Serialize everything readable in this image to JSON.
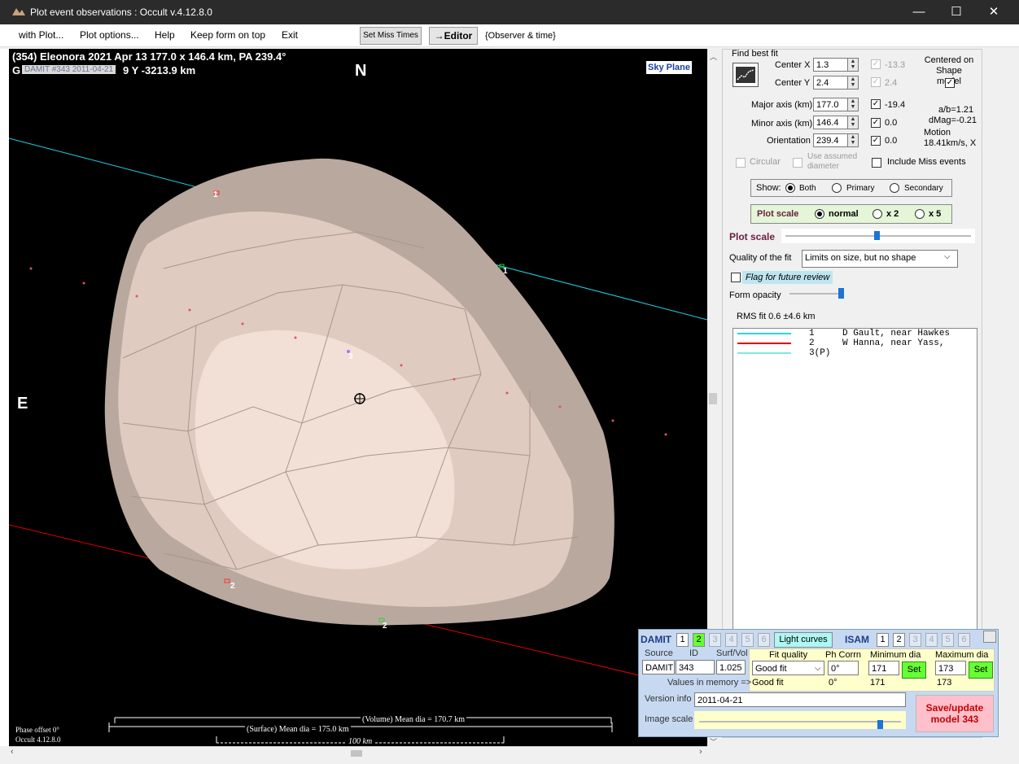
{
  "window": {
    "title": "Plot event observations : Occult v.4.12.8.0",
    "minimize": "—",
    "maximize": "☐",
    "close": "✕"
  },
  "menu": {
    "items": [
      "with Plot...",
      "Plot options...",
      "Help",
      "Keep form on top",
      "Exit"
    ],
    "set_miss_times": "Set Miss Times",
    "editor": "→Editor",
    "observer_time": "{Observer & time}"
  },
  "plot": {
    "header_line1": "(354) Eleonora  2021 Apr 13   177.0 x 146.4 km,  PA 239.4°",
    "header_line2_prefix": "G",
    "header_overlay": "DAMIT #343 2011-04-21",
    "header_line2_suffix": "9  Y -3213.9 km",
    "north": "N",
    "east": "E",
    "sky_plane": "Sky Plane",
    "chord_labels": [
      "1",
      "1",
      "2",
      "2",
      "3"
    ],
    "phase_offset": "Phase offset 0°",
    "version": "Occult 4.12.8.0",
    "volume_dia": "(Volume) Mean dia = 170.7 km",
    "surface_dia": "(Surface) Mean dia = 175.0 km",
    "scale_bar": "100 km"
  },
  "fit": {
    "find_best_fit": "Find best fit",
    "center_x_label": "Center X",
    "center_x": "1.3",
    "center_x_alt": "-13.3",
    "center_y_label": "Center Y",
    "center_y": "2.4",
    "center_y_alt": "2.4",
    "centered_on_shape": "Centered on Shape model",
    "major_label": "Major axis (km)",
    "major": "177.0",
    "major_alt": "-19.4",
    "minor_label": "Minor axis (km)",
    "minor": "146.4",
    "minor_alt": "0.0",
    "orient_label": "Orientation",
    "orient": "239.4",
    "orient_alt": "0.0",
    "ab": "a/b=1.21",
    "dmag": "dMag=-0.21",
    "motion_label": "Motion",
    "motion": "18.41km/s, X",
    "circular": "Circular",
    "use_assumed": "Use assumed diameter",
    "include_miss": "Include Miss events",
    "show_label": "Show:",
    "show_both": "Both",
    "show_primary": "Primary",
    "show_secondary": "Secondary",
    "plot_scale_label": "Plot scale",
    "scale_normal": "normal",
    "scale_x2": "x 2",
    "scale_x5": "x 5",
    "plot_scale_slider_label": "Plot scale",
    "quality_label": "Quality of the fit",
    "quality_value": "Limits on size, but no shape",
    "flag_review": "Flag for future review",
    "form_opacity": "Form opacity",
    "rms": "RMS fit 0.6 ±4.6 km"
  },
  "legend": [
    {
      "num": "1",
      "text": "D Gault, near Hawkes",
      "color": "#29d6e6"
    },
    {
      "num": "2",
      "text": "W Hanna, near Yass,",
      "color": "#e00000"
    },
    {
      "num": "3(P)",
      "text": "",
      "color": "#7fe6e6"
    }
  ],
  "damit": {
    "title": "DAMIT",
    "nums": [
      "1",
      "2",
      "3",
      "4",
      "5",
      "6"
    ],
    "light_curves": "Light curves",
    "isam": "ISAM",
    "isam_nums": [
      "1",
      "2",
      "3",
      "4",
      "5",
      "6"
    ],
    "source_label": "Source",
    "id_label": "ID",
    "surfvol_label": "Surf/Vol",
    "fit_quality_label": "Fit quality",
    "phcorr_label": "Ph Corrn",
    "min_dia_label": "Minimum dia",
    "max_dia_label": "Maximum dia",
    "source": "DAMIT",
    "id": "343",
    "surfvol": "1.025",
    "fit_quality": "Good fit",
    "phcorr": "0°",
    "min_dia": "171",
    "max_dia": "173",
    "set": "Set",
    "values_in_memory": "Values in memory =>",
    "mem_fit": "Good fit",
    "mem_phcorr": "0°",
    "mem_min": "171",
    "mem_max": "173",
    "version_label": "Version info",
    "version": "2011-04-21",
    "image_scale": "Image scale",
    "save": "Save/update model 343"
  }
}
